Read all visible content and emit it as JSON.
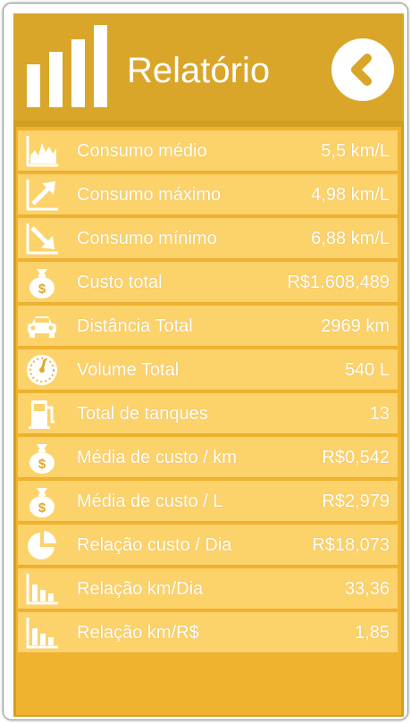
{
  "header": {
    "title": "Relatório",
    "logo_icon": "bar-chart-icon",
    "back_icon": "chevron-left-icon"
  },
  "colors": {
    "header_bg": "#d9a62a",
    "panel_bg": "#f0b32f",
    "row_bg": "#fcd26a",
    "text": "#ffffff"
  },
  "rows": [
    {
      "label": "Consumo médio",
      "value": "5,5 km/L",
      "icon": "area-chart-icon"
    },
    {
      "label": "Consumo máximo",
      "value": "4,98 km/L",
      "icon": "trend-up-icon"
    },
    {
      "label": "Consumo mínimo",
      "value": "6,88 km/L",
      "icon": "trend-down-icon"
    },
    {
      "label": "Custo total",
      "value": "R$1.608,489",
      "icon": "money-bag-icon"
    },
    {
      "label": "Distância Total",
      "value": "2969 km",
      "icon": "car-icon"
    },
    {
      "label": "Volume Total",
      "value": "540 L",
      "icon": "gauge-icon"
    },
    {
      "label": "Total de tanques",
      "value": "13",
      "icon": "fuel-pump-icon"
    },
    {
      "label": "Média de custo / km",
      "value": "R$0,542",
      "icon": "money-bag-icon"
    },
    {
      "label": "Média de custo / L",
      "value": "R$2,979",
      "icon": "money-bag-icon"
    },
    {
      "label": "Relação custo / Dia",
      "value": "R$18,073",
      "icon": "pie-chart-icon"
    },
    {
      "label": "Relação km/Dia",
      "value": "33,36",
      "icon": "bar-chart-icon"
    },
    {
      "label": "Relação km/R$",
      "value": "1,85",
      "icon": "bar-chart-icon"
    }
  ]
}
